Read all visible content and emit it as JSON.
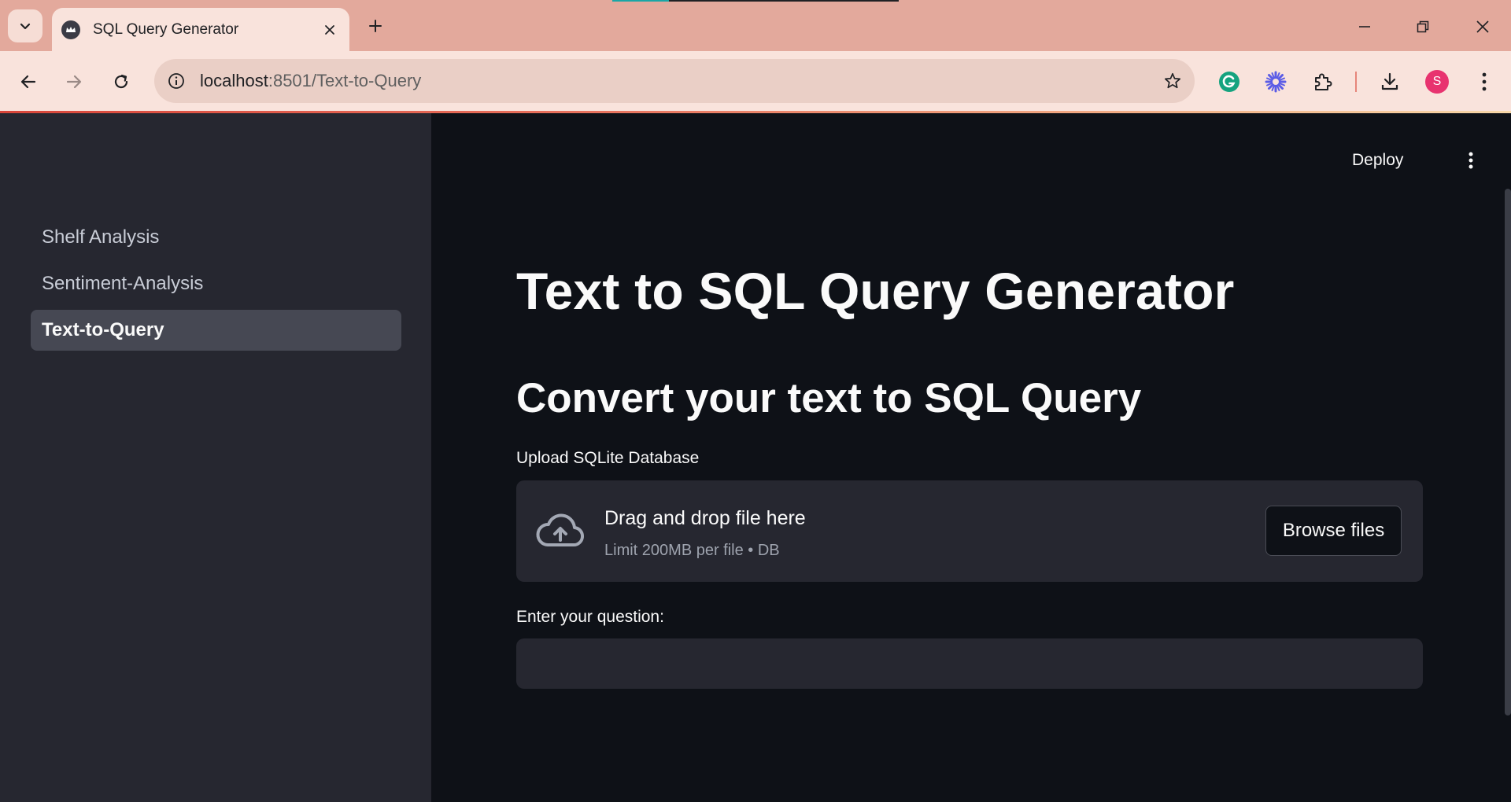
{
  "browser": {
    "tab_title": "SQL Query Generator",
    "url_host": "localhost",
    "url_path": ":8501/Text-to-Query",
    "profile_initial": "S",
    "colors": {
      "frame": "#e3a99c",
      "toolbar": "#f9e3dc",
      "avatar": "#e8336f"
    }
  },
  "sidebar": {
    "items": [
      {
        "label": "Shelf Analysis",
        "active": false
      },
      {
        "label": "Sentiment-Analysis",
        "active": false
      },
      {
        "label": "Text-to-Query",
        "active": true
      }
    ]
  },
  "header": {
    "deploy_label": "Deploy"
  },
  "main": {
    "title": "Text to SQL Query Generator",
    "subtitle": "Convert your text to SQL Query",
    "upload": {
      "label": "Upload SQLite Database",
      "dropzone_title": "Drag and drop file here",
      "limit_text": "Limit 200MB per file • DB",
      "browse_label": "Browse files"
    },
    "question": {
      "label": "Enter your question:",
      "value": ""
    }
  },
  "icons": [
    "chevron-down-icon",
    "favicon-icon",
    "close-icon",
    "plus-icon",
    "minimize-icon",
    "restore-icon",
    "back-icon",
    "forward-icon",
    "reload-icon",
    "info-icon",
    "star-icon",
    "grammarly-icon",
    "extension-flower-icon",
    "puzzle-icon",
    "download-icon",
    "more-vert-icon",
    "cloud-upload-icon"
  ]
}
